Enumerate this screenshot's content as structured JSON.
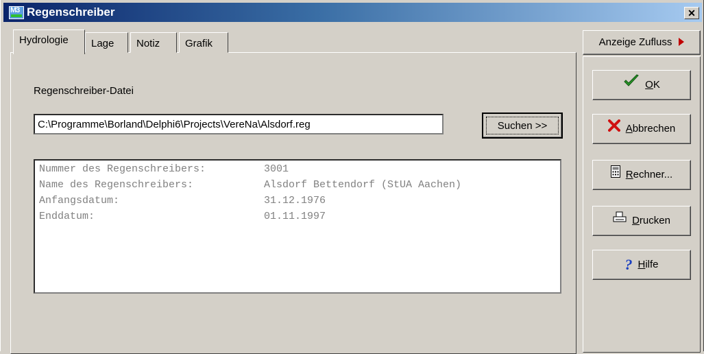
{
  "window": {
    "title": "Regenschreiber",
    "close_glyph": "✕"
  },
  "tabs": [
    {
      "label": "Hydrologie",
      "active": true
    },
    {
      "label": "Lage"
    },
    {
      "label": "Notiz"
    },
    {
      "label": "Grafik"
    }
  ],
  "hydrologie": {
    "file_label": "Regenschreiber-Datei",
    "file_value": "C:\\Programme\\Borland\\Delphi6\\Projects\\VereNa\\Alsdorf.reg",
    "search_button": "Suchen >>",
    "info": [
      {
        "key": "Nummer des Regenschreibers:",
        "value": "3001"
      },
      {
        "key": "Name des Regenschreibers:",
        "value": "Alsdorf Bettendorf (StUA Aachen)"
      },
      {
        "key": "Anfangsdatum:",
        "value": "31.12.1976"
      },
      {
        "key": "Enddatum:",
        "value": "01.11.1997"
      }
    ]
  },
  "side": {
    "zufluss_label": "Anzeige Zufluss",
    "ok": {
      "mnemonic": "O",
      "rest": "K",
      "icon": "check-icon"
    },
    "abbrechen": {
      "mnemonic": "A",
      "rest": "bbrechen",
      "icon": "x-icon"
    },
    "rechner": {
      "mnemonic": "R",
      "rest": "echner...",
      "icon": "calculator-icon"
    },
    "drucken": {
      "mnemonic": "D",
      "rest": "rucken",
      "icon": "printer-icon"
    },
    "hilfe": {
      "mnemonic": "H",
      "rest": "ilfe",
      "icon": "question-icon"
    }
  },
  "colors": {
    "title_start": "#0a246a",
    "title_end": "#a6caf0",
    "face": "#d4d0c8",
    "info_text": "#808080",
    "check": "#2a9a2a",
    "cancel": "#d01010",
    "help": "#1a3fc0"
  }
}
